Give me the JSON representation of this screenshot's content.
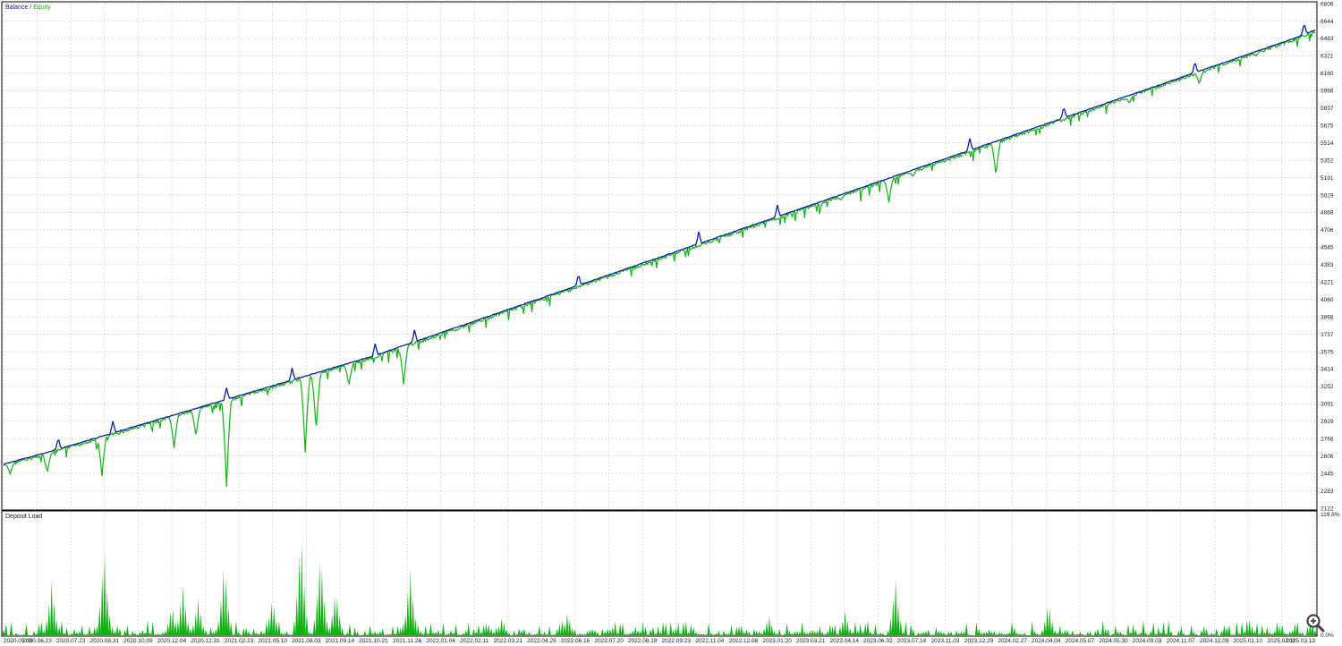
{
  "legend": {
    "balance_label": "Balance",
    "separator": " / ",
    "equity_label": "Equity",
    "deposit_load_label": "Deposit Load"
  },
  "colors": {
    "balance": "#0a1fa8",
    "equity": "#12b212",
    "deposit_load": "#10b010",
    "grid": "#c8c8c8",
    "axis": "#000000"
  },
  "icons": {
    "zoom": "magnifier-plus-icon"
  },
  "chart_data": [
    {
      "type": "line",
      "series": [
        {
          "name": "Balance",
          "values": [
            2530,
            2585,
            2640,
            2700,
            2760,
            2820,
            2880,
            2940,
            3000,
            3060,
            3120,
            3180,
            3240,
            3300,
            3360,
            3420,
            3480,
            3540,
            3610,
            3680,
            3750,
            3820,
            3890,
            3960,
            4030,
            4100,
            4170,
            4240,
            4310,
            4380,
            4450,
            4520,
            4590,
            4660,
            4730,
            4800,
            4870,
            4940,
            5010,
            5080,
            5150,
            5220,
            5290,
            5360,
            5430,
            5500,
            5570,
            5640,
            5710,
            5780,
            5850,
            5920,
            5990,
            6060,
            6130,
            6200,
            6270,
            6340,
            6410,
            6480,
            6560
          ]
        },
        {
          "name": "Equity",
          "drawdowns": [
            {
              "x": 0.3,
              "low": 2440
            },
            {
              "x": 2.0,
              "low": 2450
            },
            {
              "x": 4.5,
              "low": 2420
            },
            {
              "x": 7.8,
              "low": 2680
            },
            {
              "x": 8.8,
              "low": 2790
            },
            {
              "x": 10.2,
              "low": 2320
            },
            {
              "x": 13.8,
              "low": 2640
            },
            {
              "x": 14.3,
              "low": 2840
            },
            {
              "x": 15.8,
              "low": 3260
            },
            {
              "x": 18.3,
              "low": 3270
            },
            {
              "x": 22.6,
              "low": 4070
            },
            {
              "x": 25.5,
              "low": 4370
            },
            {
              "x": 31.7,
              "low": 4690
            },
            {
              "x": 37.0,
              "low": 4930
            },
            {
              "x": 38.3,
              "low": 4980
            },
            {
              "x": 40.5,
              "low": 4960
            },
            {
              "x": 41.6,
              "low": 5200
            },
            {
              "x": 45.4,
              "low": 5210
            },
            {
              "x": 51.5,
              "low": 5880
            },
            {
              "x": 54.7,
              "low": 6060
            },
            {
              "x": 57.3,
              "low": 6320
            }
          ]
        }
      ],
      "ylim": [
        2122,
        6806
      ],
      "yticks": [
        "6806",
        "6644",
        "6483",
        "6321",
        "6160",
        "5998",
        "5837",
        "5675",
        "5514",
        "5352",
        "5191",
        "5029",
        "4868",
        "4706",
        "4545",
        "4383",
        "4221",
        "4060",
        "3898",
        "3737",
        "3575",
        "3414",
        "3252",
        "3091",
        "2929",
        "2768",
        "2606",
        "2445",
        "2283",
        "2122"
      ],
      "x_count": 61
    },
    {
      "type": "bar",
      "series": [
        {
          "name": "Deposit Load",
          "peaks": [
            {
              "x": 2.2,
              "v": 60
            },
            {
              "x": 4.6,
              "v": 97
            },
            {
              "x": 7.7,
              "v": 34
            },
            {
              "x": 8.2,
              "v": 56
            },
            {
              "x": 8.9,
              "v": 40
            },
            {
              "x": 10.1,
              "v": 84
            },
            {
              "x": 12.3,
              "v": 43
            },
            {
              "x": 13.6,
              "v": 119
            },
            {
              "x": 14.5,
              "v": 97
            },
            {
              "x": 15.2,
              "v": 53
            },
            {
              "x": 18.6,
              "v": 75
            },
            {
              "x": 22.8,
              "v": 20
            },
            {
              "x": 25.8,
              "v": 25
            },
            {
              "x": 35.0,
              "v": 22
            },
            {
              "x": 38.5,
              "v": 27
            },
            {
              "x": 40.8,
              "v": 63
            },
            {
              "x": 47.8,
              "v": 37
            },
            {
              "x": 57.0,
              "v": 17
            }
          ]
        }
      ],
      "ylim": [
        0,
        119.8
      ],
      "ytick_top": "119.8%",
      "ytick_bottom": "0.0%"
    }
  ],
  "x_axis": {
    "tick_labels": [
      "2020.05.08",
      "2020.06.23",
      "2020.07.23",
      "2020.08.31",
      "2020.10.09",
      "2020.12.04",
      "2020.12.31",
      "2021.02.23",
      "2021.05.10",
      "2021.08.03",
      "2021.09.14",
      "2021.10.21",
      "2021.11.26",
      "2022.01.04",
      "2022.02.11",
      "2022.03.21",
      "2022.04.29",
      "2022.06.16",
      "2022.07.20",
      "2022.08.18",
      "2022.09.23",
      "2022.11.04",
      "2022.12.06",
      "2023.01.20",
      "2023.03.21",
      "2023.04.14",
      "2023.06.02",
      "2023.07.14",
      "2023.11.03",
      "2023.12.29",
      "2024.02.27",
      "2024.04.04",
      "2024.05.07",
      "2024.05.30",
      "2024.09.03",
      "2024.11.07",
      "2024.12.09",
      "2025.01.10",
      "2025.02.11",
      "2025.03.13"
    ]
  }
}
